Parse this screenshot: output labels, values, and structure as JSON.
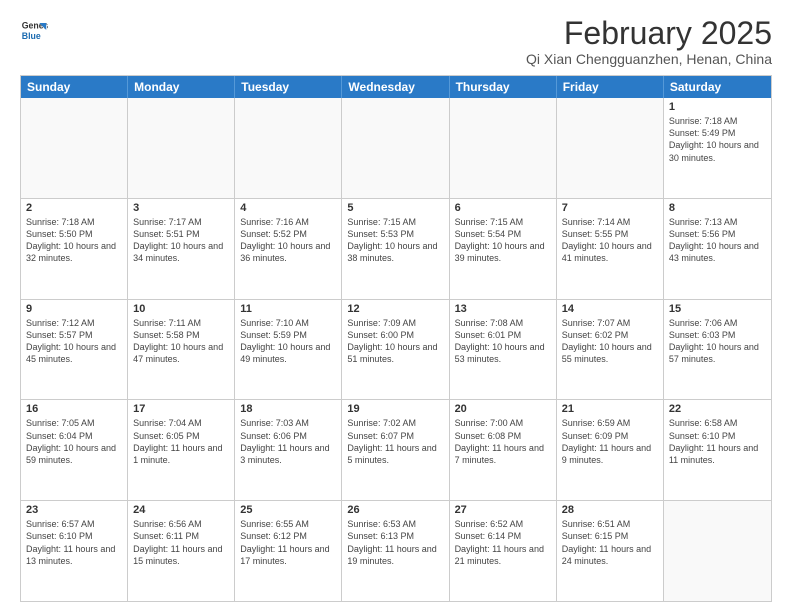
{
  "logo": {
    "line1": "General",
    "line2": "Blue"
  },
  "title": "February 2025",
  "location": "Qi Xian Chengguanzhen, Henan, China",
  "weekdays": [
    "Sunday",
    "Monday",
    "Tuesday",
    "Wednesday",
    "Thursday",
    "Friday",
    "Saturday"
  ],
  "rows": [
    [
      {
        "day": "",
        "info": ""
      },
      {
        "day": "",
        "info": ""
      },
      {
        "day": "",
        "info": ""
      },
      {
        "day": "",
        "info": ""
      },
      {
        "day": "",
        "info": ""
      },
      {
        "day": "",
        "info": ""
      },
      {
        "day": "1",
        "info": "Sunrise: 7:18 AM\nSunset: 5:49 PM\nDaylight: 10 hours and 30 minutes."
      }
    ],
    [
      {
        "day": "2",
        "info": "Sunrise: 7:18 AM\nSunset: 5:50 PM\nDaylight: 10 hours and 32 minutes."
      },
      {
        "day": "3",
        "info": "Sunrise: 7:17 AM\nSunset: 5:51 PM\nDaylight: 10 hours and 34 minutes."
      },
      {
        "day": "4",
        "info": "Sunrise: 7:16 AM\nSunset: 5:52 PM\nDaylight: 10 hours and 36 minutes."
      },
      {
        "day": "5",
        "info": "Sunrise: 7:15 AM\nSunset: 5:53 PM\nDaylight: 10 hours and 38 minutes."
      },
      {
        "day": "6",
        "info": "Sunrise: 7:15 AM\nSunset: 5:54 PM\nDaylight: 10 hours and 39 minutes."
      },
      {
        "day": "7",
        "info": "Sunrise: 7:14 AM\nSunset: 5:55 PM\nDaylight: 10 hours and 41 minutes."
      },
      {
        "day": "8",
        "info": "Sunrise: 7:13 AM\nSunset: 5:56 PM\nDaylight: 10 hours and 43 minutes."
      }
    ],
    [
      {
        "day": "9",
        "info": "Sunrise: 7:12 AM\nSunset: 5:57 PM\nDaylight: 10 hours and 45 minutes."
      },
      {
        "day": "10",
        "info": "Sunrise: 7:11 AM\nSunset: 5:58 PM\nDaylight: 10 hours and 47 minutes."
      },
      {
        "day": "11",
        "info": "Sunrise: 7:10 AM\nSunset: 5:59 PM\nDaylight: 10 hours and 49 minutes."
      },
      {
        "day": "12",
        "info": "Sunrise: 7:09 AM\nSunset: 6:00 PM\nDaylight: 10 hours and 51 minutes."
      },
      {
        "day": "13",
        "info": "Sunrise: 7:08 AM\nSunset: 6:01 PM\nDaylight: 10 hours and 53 minutes."
      },
      {
        "day": "14",
        "info": "Sunrise: 7:07 AM\nSunset: 6:02 PM\nDaylight: 10 hours and 55 minutes."
      },
      {
        "day": "15",
        "info": "Sunrise: 7:06 AM\nSunset: 6:03 PM\nDaylight: 10 hours and 57 minutes."
      }
    ],
    [
      {
        "day": "16",
        "info": "Sunrise: 7:05 AM\nSunset: 6:04 PM\nDaylight: 10 hours and 59 minutes."
      },
      {
        "day": "17",
        "info": "Sunrise: 7:04 AM\nSunset: 6:05 PM\nDaylight: 11 hours and 1 minute."
      },
      {
        "day": "18",
        "info": "Sunrise: 7:03 AM\nSunset: 6:06 PM\nDaylight: 11 hours and 3 minutes."
      },
      {
        "day": "19",
        "info": "Sunrise: 7:02 AM\nSunset: 6:07 PM\nDaylight: 11 hours and 5 minutes."
      },
      {
        "day": "20",
        "info": "Sunrise: 7:00 AM\nSunset: 6:08 PM\nDaylight: 11 hours and 7 minutes."
      },
      {
        "day": "21",
        "info": "Sunrise: 6:59 AM\nSunset: 6:09 PM\nDaylight: 11 hours and 9 minutes."
      },
      {
        "day": "22",
        "info": "Sunrise: 6:58 AM\nSunset: 6:10 PM\nDaylight: 11 hours and 11 minutes."
      }
    ],
    [
      {
        "day": "23",
        "info": "Sunrise: 6:57 AM\nSunset: 6:10 PM\nDaylight: 11 hours and 13 minutes."
      },
      {
        "day": "24",
        "info": "Sunrise: 6:56 AM\nSunset: 6:11 PM\nDaylight: 11 hours and 15 minutes."
      },
      {
        "day": "25",
        "info": "Sunrise: 6:55 AM\nSunset: 6:12 PM\nDaylight: 11 hours and 17 minutes."
      },
      {
        "day": "26",
        "info": "Sunrise: 6:53 AM\nSunset: 6:13 PM\nDaylight: 11 hours and 19 minutes."
      },
      {
        "day": "27",
        "info": "Sunrise: 6:52 AM\nSunset: 6:14 PM\nDaylight: 11 hours and 21 minutes."
      },
      {
        "day": "28",
        "info": "Sunrise: 6:51 AM\nSunset: 6:15 PM\nDaylight: 11 hours and 24 minutes."
      },
      {
        "day": "",
        "info": ""
      }
    ]
  ]
}
